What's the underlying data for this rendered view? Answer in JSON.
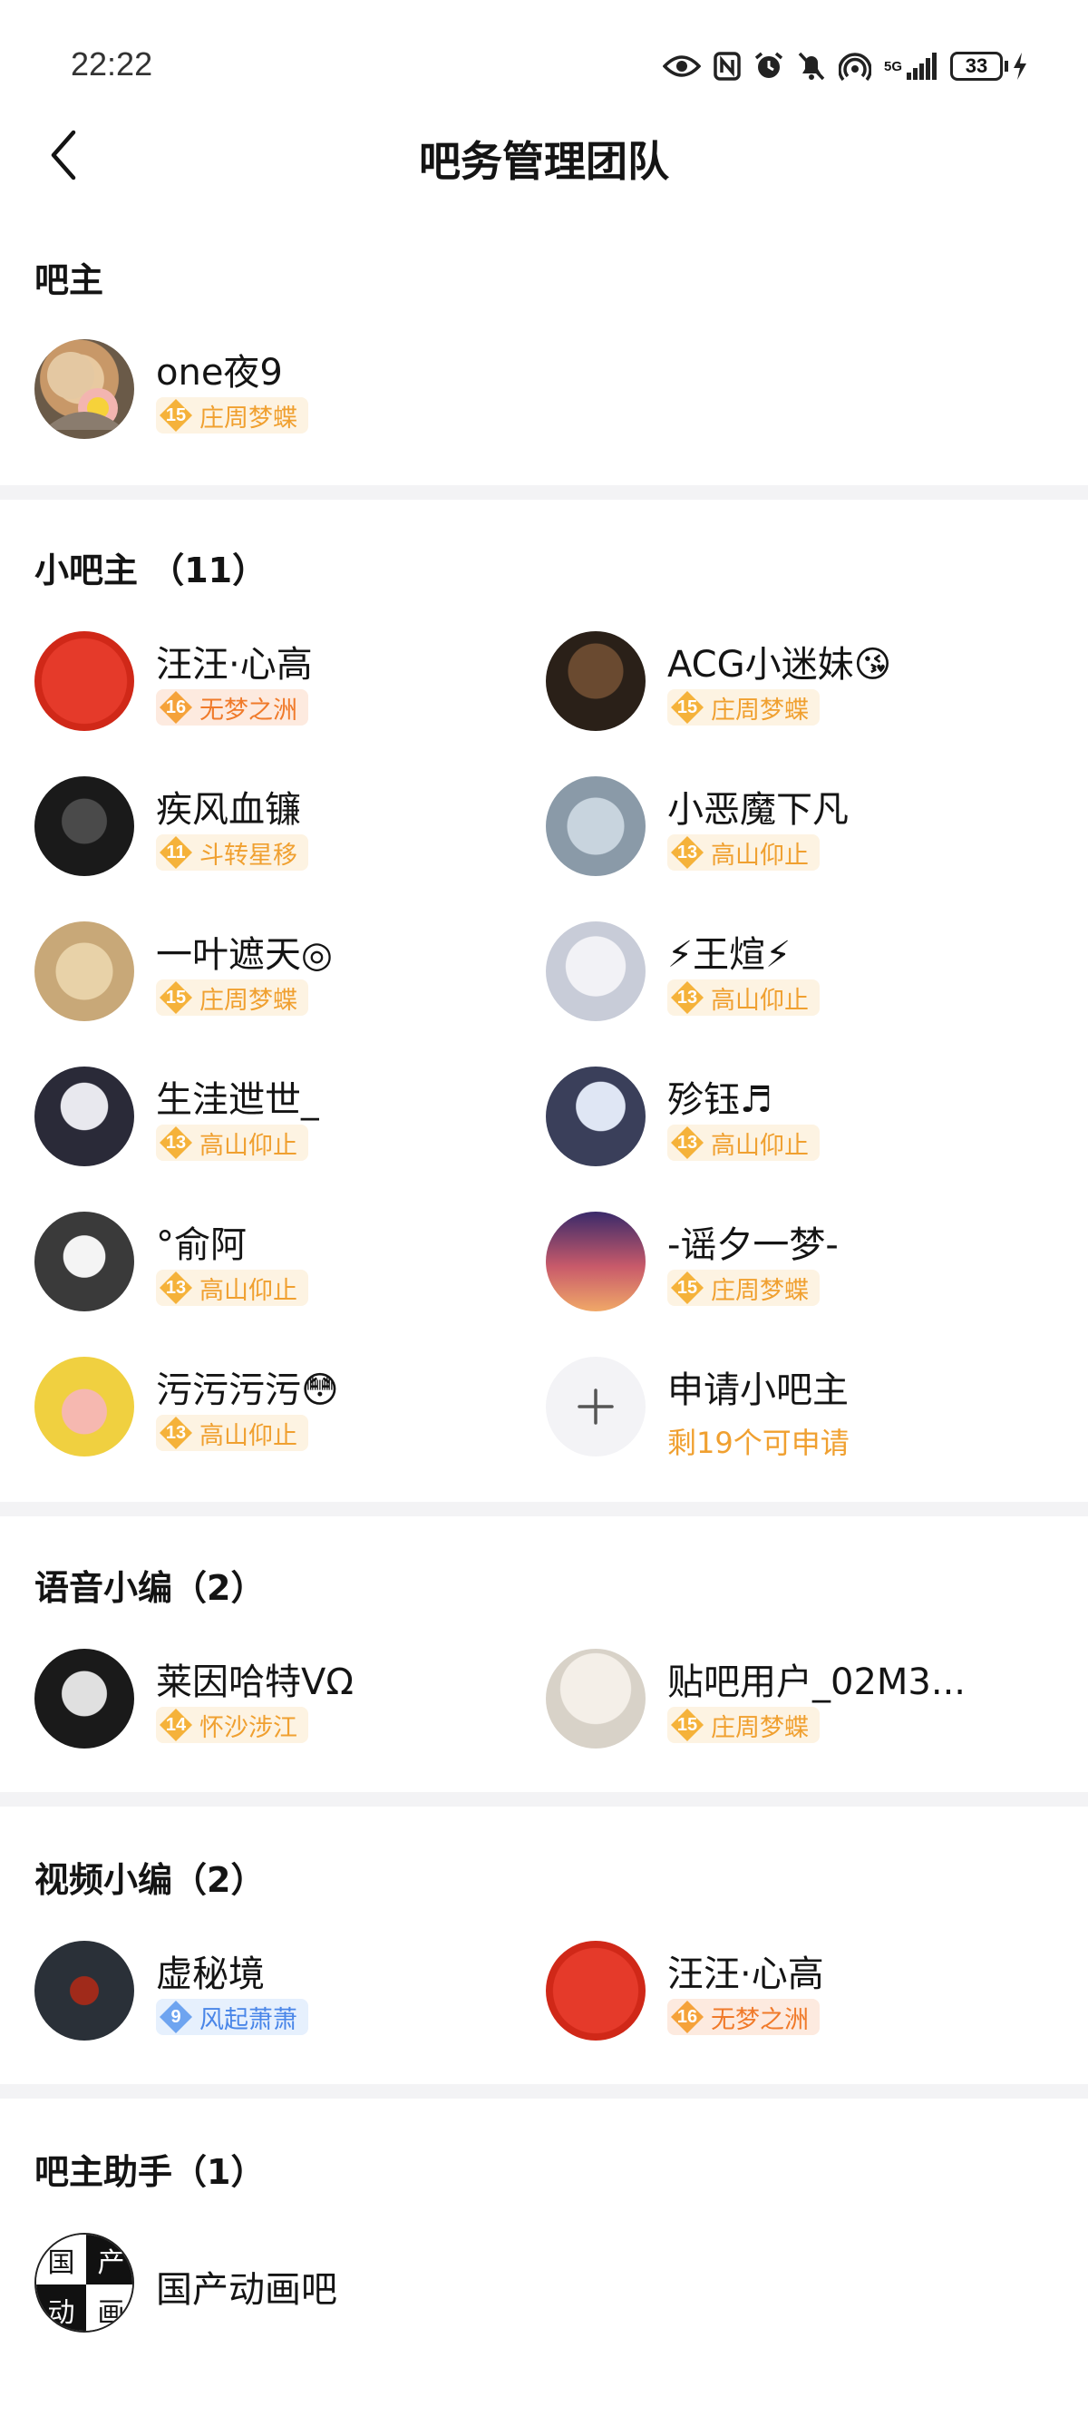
{
  "status": {
    "time": "22:22",
    "battery": "33",
    "network": "5G"
  },
  "header": {
    "title": "吧务管理团队"
  },
  "owner": {
    "title": "吧主",
    "members": [
      {
        "name": "one夜9",
        "level": "15",
        "badge": "庄周梦蝶",
        "badge_color": "orange"
      }
    ]
  },
  "sub_owners": {
    "title": "小吧主 （11）",
    "members": [
      {
        "name": "汪汪·心高",
        "level": "16",
        "badge": "无梦之洲",
        "badge_color": "red"
      },
      {
        "name": "ACG小迷妹😘",
        "level": "15",
        "badge": "庄周梦蝶",
        "badge_color": "orange"
      },
      {
        "name": "疾风血镰",
        "level": "11",
        "badge": "斗转星移",
        "badge_color": "orange"
      },
      {
        "name": "小恶魔下凡",
        "level": "13",
        "badge": "高山仰止",
        "badge_color": "orange"
      },
      {
        "name": "一叶遮天◎",
        "level": "15",
        "badge": "庄周梦蝶",
        "badge_color": "orange"
      },
      {
        "name": "⚡王煊⚡",
        "level": "13",
        "badge": "高山仰止",
        "badge_color": "orange"
      },
      {
        "name": "生洼迣世_",
        "level": "13",
        "badge": "高山仰止",
        "badge_color": "orange"
      },
      {
        "name": "殄钰♬",
        "level": "13",
        "badge": "高山仰止",
        "badge_color": "orange"
      },
      {
        "name": "°俞阿",
        "level": "13",
        "badge": "高山仰止",
        "badge_color": "orange"
      },
      {
        "name": "-谣夕一梦-",
        "level": "15",
        "badge": "庄周梦蝶",
        "badge_color": "orange"
      },
      {
        "name": "污污污污😳",
        "level": "13",
        "badge": "高山仰止",
        "badge_color": "orange"
      }
    ],
    "apply": {
      "label": "申请小吧主",
      "sub": "剩19个可申请",
      "icon": "plus-icon"
    }
  },
  "voice_editors": {
    "title": "语音小编（2）",
    "members": [
      {
        "name": "莱因哈特VΩ",
        "level": "14",
        "badge": "怀沙涉江",
        "badge_color": "orange"
      },
      {
        "name": "贴吧用户_02M3...",
        "level": "15",
        "badge": "庄周梦蝶",
        "badge_color": "orange"
      }
    ]
  },
  "video_editors": {
    "title": "视频小编（2）",
    "members": [
      {
        "name": "虚秘境",
        "level": "9",
        "badge": "风起萧萧",
        "badge_color": "blue"
      },
      {
        "name": "汪汪·心高",
        "level": "16",
        "badge": "无梦之洲",
        "badge_color": "red"
      }
    ]
  },
  "assistants": {
    "title": "吧主助手（1）",
    "members": [
      {
        "name": "国产动画吧",
        "avatar_text": [
          "国",
          "产",
          "动",
          "画"
        ]
      }
    ]
  },
  "colors": {
    "orange": "#f0a030",
    "red": "#f07a2a",
    "blue": "#4a86e8",
    "divider": "#f3f3f5"
  }
}
